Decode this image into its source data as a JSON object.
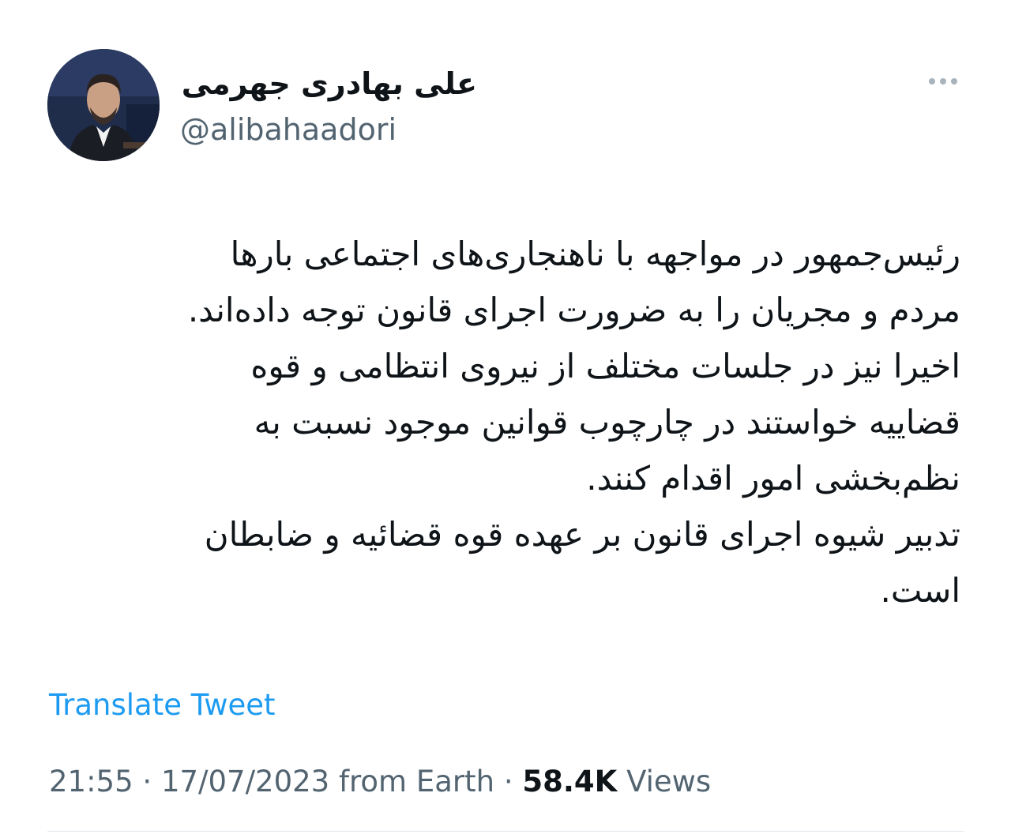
{
  "tweet": {
    "author": {
      "display_name": "علی بهادری جهرمی",
      "handle": "@alibahaadori"
    },
    "more_icon": "more-horizontal-icon",
    "lines": [
      "رئیس‌جمهور در مواجهه با ناهنجاری‌های اجتماعی بارها",
      "مردم و مجریان را به ضرورت اجرای قانون توجه داده‌اند.",
      "اخیرا نیز در جلسات مختلف از نیروی انتظامی و قوه",
      "قضاییه خواستند در چارچوب قوانین موجود نسبت به",
      "نظم‌بخشی امور اقدام کنند.",
      "تدبیر شیوه اجرای قانون بر عهده قوه قضائیه و ضابطان",
      "است."
    ],
    "translate_label": "Translate Tweet",
    "time": "21:55",
    "date": "17/07/2023",
    "source": "from Earth",
    "separator": "·",
    "views_count": "58.4K",
    "views_label": "Views"
  },
  "colors": {
    "text": "#0f1419",
    "secondary": "#536471",
    "link": "#1d9bf0",
    "divider": "#e1e8ed"
  }
}
